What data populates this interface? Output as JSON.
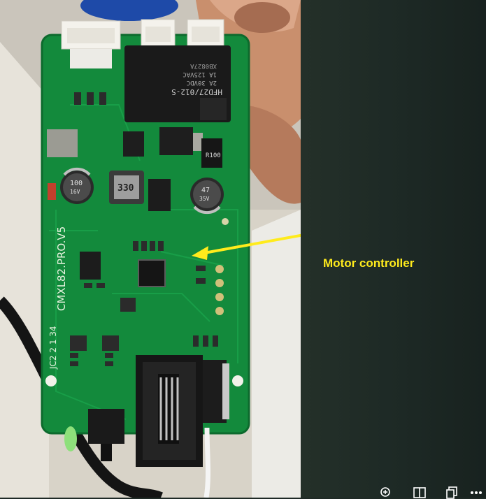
{
  "annotation": {
    "label": "Motor controller",
    "color": "#ffeb1c"
  },
  "board": {
    "silkscreen_main": "CMXL82.PRO.V5",
    "silkscreen_left": "JC2 2 1 34",
    "relay_model": "HFD27/012-S",
    "relay_rating_1": "2A 30VDC",
    "relay_rating_2": "1A 125VAC",
    "relay_code": "XB0827A",
    "inductor_marking": "330",
    "cap_left_value": "100",
    "cap_left_voltage": "16V",
    "cap_right_value": "47",
    "cap_right_voltage": "35V",
    "resistor_marking": "R100",
    "pcb_color": "#138a3c",
    "connector_color": "#f4f2ec"
  },
  "toolbar": {
    "icons": [
      "zoom-in-icon",
      "reader-icon",
      "copy-icon",
      "more-icon"
    ]
  }
}
